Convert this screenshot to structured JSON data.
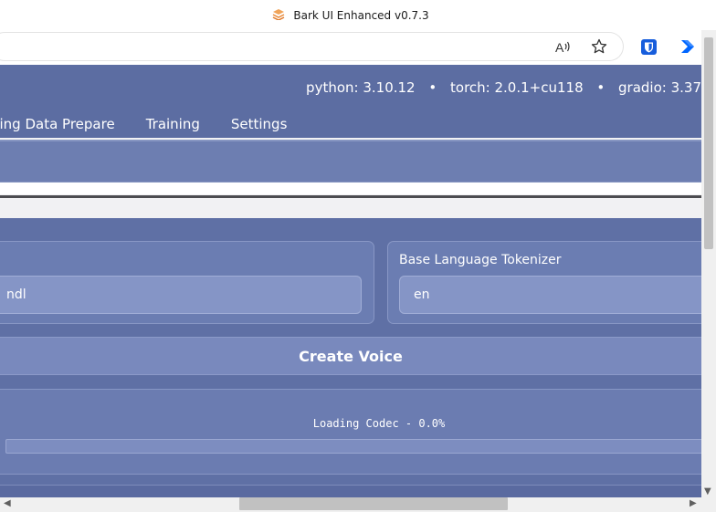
{
  "window": {
    "title": "Bark UI Enhanced v0.7.3"
  },
  "header": {
    "versions": [
      {
        "label": "python: 3.10.12"
      },
      {
        "label": "torch: 2.0.1+cu118"
      },
      {
        "label": "gradio: 3.37"
      }
    ],
    "separator": "•"
  },
  "nav": {
    "tabs": [
      {
        "label": "ning Data Prepare"
      },
      {
        "label": "Training"
      },
      {
        "label": "Settings"
      }
    ]
  },
  "voice_form": {
    "left_field_value": "ndl",
    "tokenizer_label": "Base Language Tokenizer",
    "tokenizer_value": "en",
    "create_button_label": "Create Voice"
  },
  "progress": {
    "text": "Loading Codec - 0.0%",
    "value": 0.0
  },
  "icons": {
    "read_aloud": "read-aloud-icon",
    "favorite": "star-icon",
    "bitwarden": "bitwarden-icon",
    "power_automate": "power-automate-icon"
  },
  "colors": {
    "header": "#5c6da2",
    "accent": "#7989bd",
    "bitwarden": "#175ddc",
    "power_automate": "#0066ff"
  }
}
